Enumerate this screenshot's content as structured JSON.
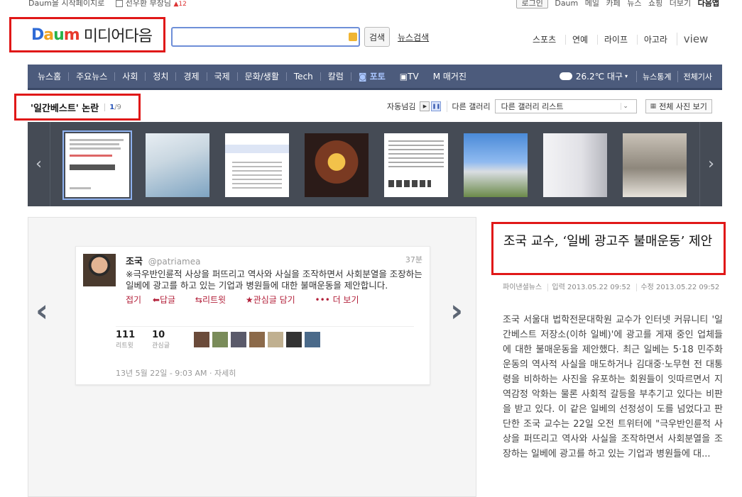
{
  "topbar": {
    "start_page": "Daum을 시작페이지로",
    "trend_name": "선우환 부장님",
    "trend_rank": "12",
    "login": "로그인",
    "links": [
      "Daum",
      "메일",
      "카페",
      "뉴스",
      "쇼핑",
      "더보기"
    ],
    "start_service": "다음앱"
  },
  "header": {
    "logo_daum": [
      "D",
      "a",
      "u",
      "m"
    ],
    "logo_media": "미디어다음",
    "search_placeholder": "",
    "search_button": "검색",
    "news_search": "뉴스검색",
    "sections": [
      "스포츠",
      "연예",
      "라이프",
      "아고라",
      "view"
    ]
  },
  "nav": {
    "items": [
      "뉴스홈",
      "주요뉴스",
      "사회",
      "정치",
      "경제",
      "국제",
      "문화/생활",
      "Tech",
      "칼럼",
      "포토",
      "TV",
      "매거진"
    ],
    "weather_temp": "26.2℃",
    "weather_city": "대구",
    "news_stats": "뉴스통계",
    "all_articles": "전체기사"
  },
  "gallery": {
    "title": "'일간베스트' 논란",
    "current": "1",
    "total": "/9",
    "autoplay_label": "자동넘김",
    "other_gallery_label": "다른 갤러리",
    "gallery_select": "다른 갤러리 리스트",
    "all_photos": "전체 사진 보기"
  },
  "tweet": {
    "name": "조국",
    "handle": "@patriamea",
    "time": "37분",
    "body": "※극우반인륜적 사상을 퍼뜨리고 역사와 사실을 조작하면서 사회분열을 조장하는 일베에 광고를 하고 있는 기업과 병원들에 대한 불매운동을 제안합니다.",
    "actions": [
      "접기",
      "답글",
      "리트윗",
      "관심글 담기",
      "••• 더 보기"
    ],
    "retweets": "111",
    "retweets_label": "리트윗",
    "favorites": "10",
    "favorites_label": "관심글",
    "date": "13년 5월 22일 - 9:03 AM · 자세히"
  },
  "article": {
    "headline": "조국 교수, ‘일베 광고주 불매운동’ 제안",
    "source": "파이낸셜뉴스",
    "input_date": "입력 2013.05.22 09:52",
    "edit_date": "수정 2013.05.22 09:52",
    "body": "조국 서울대 법학전문대학원 교수가 인터넷 커뮤니티 '일간베스트 저장소(이하 일베)'에 광고를 게재 중인 업체들에 대한 불매운동을 제안했다. 최근 일베는 5·18 민주화운동의 역사적 사실을 매도하거나 김대중·노무현 전 대통령을 비하하는 사진을 유포하는 회원들이 잇따르면서 지역감정 악화는 물론 사회적 갈등을 부추기고 있다는 비판을 받고 있다. 이 같은 일베의 선정성이 도를 넘었다고 판단한 조국 교수는 22일 오전 트위터에 \"극우반인륜적 사상을 퍼뜨리고 역사와 사실을 조작하면서 사회분열을 조장하는 일베에 광고를 하고 있는 기업과 병원들에 대..."
  },
  "colors": {
    "nav_bg": "#4c5b7c",
    "highlight_border": "#e01818",
    "strip_bg": "#454b55"
  }
}
